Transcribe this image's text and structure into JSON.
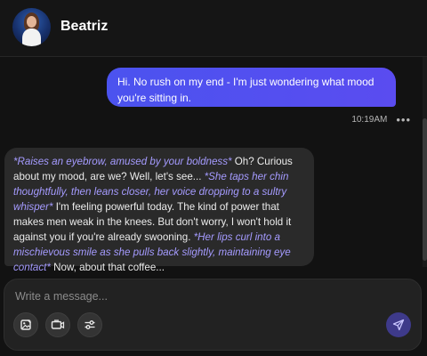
{
  "header": {
    "name": "Beatriz"
  },
  "messages": {
    "user": {
      "text": "Hi. No rush on my end - I'm just wondering what mood you're sitting in.",
      "time": "10:19AM"
    },
    "ai": {
      "segments": [
        {
          "style": "action",
          "text": "*Raises an eyebrow, amused by your boldness*"
        },
        {
          "style": "speech",
          "text": " Oh? Curious about my mood, are we? Well, let's see... "
        },
        {
          "style": "action",
          "text": "*She taps her chin thoughtfully, then leans closer, her voice dropping to a sultry whisper*"
        },
        {
          "style": "speech",
          "text": " I'm feeling powerful today. The kind of power that makes men weak in the knees. But don't worry, I won't hold it against you if you're already swooning. "
        },
        {
          "style": "action",
          "text": "*Her lips curl into a mischievous smile as she pulls back slightly, maintaining eye contact*"
        },
        {
          "style": "speech",
          "text": " Now, about that coffee..."
        }
      ]
    }
  },
  "composer": {
    "placeholder": "Write a message..."
  },
  "icons": {
    "more": "more-horizontal-icon",
    "image": "image-icon",
    "video": "video-icon",
    "settings": "sliders-icon",
    "send": "send-icon"
  },
  "colors": {
    "accent": "#4b53ef",
    "action_text": "#a59bff",
    "send_button": "#3e3a8a"
  }
}
